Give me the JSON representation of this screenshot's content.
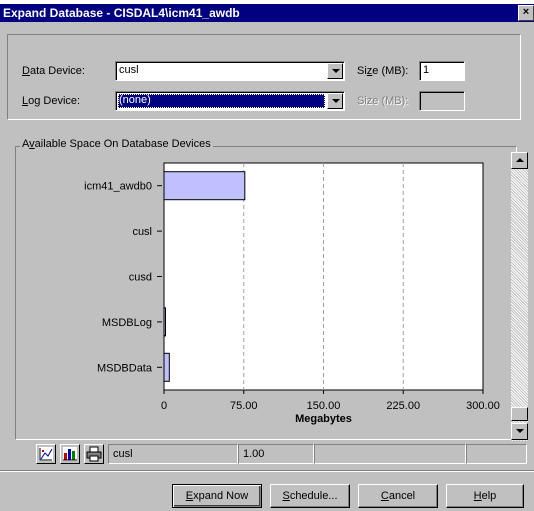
{
  "window": {
    "title": "Expand Database - CISDAL4\\icm41_awdb",
    "close_glyph": "×"
  },
  "data_device": {
    "label_underlined": "D",
    "label_rest": "ata Device:",
    "value": "cusl",
    "size_label_pre": "Si",
    "size_label_underlined": "z",
    "size_label_post": "e (MB):",
    "size_value": "1"
  },
  "log_device": {
    "label_underlined": "L",
    "label_rest": "og Device:",
    "value": "(none)",
    "size_label": "Size (MB):",
    "size_value": ""
  },
  "available_space": {
    "legend_pre": "A",
    "legend_underlined": "v",
    "legend_post": "ailable Space On Database Devices"
  },
  "chart_data": {
    "type": "bar",
    "orientation": "horizontal",
    "categories": [
      "icm41_awdb0",
      "cusl",
      "cusd",
      "MSDBLog",
      "MSDBData"
    ],
    "values": [
      76,
      0,
      0,
      1,
      5
    ],
    "xlabel": "Megabytes",
    "xlim": [
      0,
      300
    ],
    "xticks": [
      "0",
      "75.00",
      "150.00",
      "225.00",
      "300.00"
    ],
    "grid": "vertical-dashed",
    "bar_color": "#c0c0ff"
  },
  "status_bar": {
    "device": "cusl",
    "value": "1.00"
  },
  "toolbar_icons": [
    "scatter-chart-icon",
    "bar-chart-icon",
    "printer-icon"
  ],
  "buttons": {
    "expand_now": {
      "u": "E",
      "rest": "xpand Now"
    },
    "schedule": {
      "u": "S",
      "rest": "chedule..."
    },
    "cancel": {
      "u": "C",
      "rest": "ancel"
    },
    "help": {
      "u": "H",
      "rest": "elp"
    }
  }
}
